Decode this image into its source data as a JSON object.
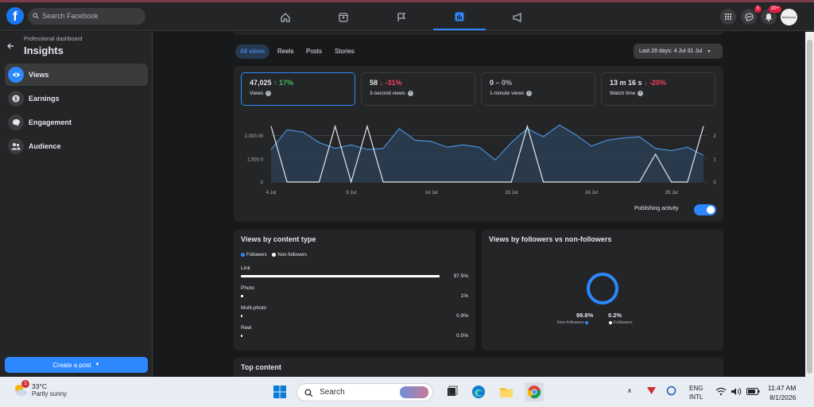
{
  "topbar": {
    "search_placeholder": "Search Facebook",
    "notification_badge": "20+",
    "messenger_badge": "5",
    "avatar_text": "freelancer"
  },
  "sidebar": {
    "subtitle": "Professional dashboard",
    "title": "Insights",
    "items": [
      {
        "label": "Views",
        "icon": "eye-icon"
      },
      {
        "label": "Earnings",
        "icon": "dollar-icon"
      },
      {
        "label": "Engagement",
        "icon": "chat-icon"
      },
      {
        "label": "Audience",
        "icon": "people-icon"
      }
    ],
    "create_post": "Create a post"
  },
  "tabs": [
    "All views",
    "Reels",
    "Posts",
    "Stories"
  ],
  "date_range": "Last 28 days: 4 Jul-31 Jul",
  "metrics": [
    {
      "value": "47,025",
      "change": "↑ 17%",
      "trend": "up",
      "label": "Views"
    },
    {
      "value": "58",
      "change": "↓ -31%",
      "trend": "down",
      "label": "3-second views"
    },
    {
      "value": "0",
      "change": "– 0%",
      "trend": "neutral",
      "label": "1-minute views"
    },
    {
      "value": "13 m 16 s",
      "change": "↓ -20%",
      "trend": "down",
      "label": "Watch time"
    }
  ],
  "chart_data": {
    "type": "line",
    "x_ticks": [
      "4 Jul",
      "9 Jul",
      "14 Jul",
      "19 Jul",
      "24 Jul",
      "29 Jul"
    ],
    "y_left_ticks": [
      "2,000.00",
      "1,000.0",
      "0"
    ],
    "y_right_ticks": [
      "2",
      "1",
      "0"
    ],
    "ylim_left": [
      0,
      2600
    ],
    "ylim_right": [
      0,
      2.6
    ],
    "series": [
      {
        "type": "area",
        "color": "#4a90d9",
        "axis": "left",
        "values": [
          1400,
          2250,
          2150,
          1700,
          1450,
          1600,
          1400,
          1450,
          2300,
          1800,
          1750,
          1500,
          1600,
          1500,
          950,
          1700,
          2300,
          1950,
          2450,
          2050,
          1550,
          1800,
          1900,
          1950,
          1450,
          1350,
          1500,
          1150
        ]
      },
      {
        "type": "line",
        "color": "#e4e6eb",
        "axis": "right",
        "values": [
          2.4,
          0,
          0,
          0,
          2.4,
          0,
          2.4,
          0,
          0,
          0,
          0,
          0,
          0,
          0,
          0,
          0,
          2.4,
          0,
          0,
          0,
          0,
          0,
          0,
          0,
          1.2,
          0,
          0,
          2.4
        ]
      }
    ],
    "publishing_activity_label": "Publishing activity"
  },
  "content_type": {
    "title": "Views by content type",
    "legend": [
      "Followers",
      "Non-followers"
    ],
    "rows": [
      {
        "label": "Link",
        "pct": "97.5%",
        "fraction": 0.975
      },
      {
        "label": "Photo",
        "pct": "1%",
        "fraction": 0.01
      },
      {
        "label": "Multi-photo",
        "pct": "0.9%",
        "fraction": 0.009
      },
      {
        "label": "Reel",
        "pct": "0.5%",
        "fraction": 0.005
      }
    ]
  },
  "followers": {
    "title": "Views by followers vs non-followers",
    "non_followers_pct": "99.8%",
    "non_followers_label": "Non-followers",
    "followers_pct": "0.2%",
    "followers_label": "Followers",
    "non_followers_fraction": 0.998
  },
  "top_content": {
    "title": "Top content"
  },
  "taskbar": {
    "weather_temp": "33°C",
    "weather_desc": "Partly sunny",
    "weather_badge": "1",
    "search_label": "Search",
    "lang_top": "ENG",
    "lang_bottom": "INTL",
    "time": "11:47 AM",
    "date": "8/1/2026"
  },
  "colors": {
    "accent": "#2d88ff",
    "card": "#242526",
    "background": "#18191a"
  }
}
